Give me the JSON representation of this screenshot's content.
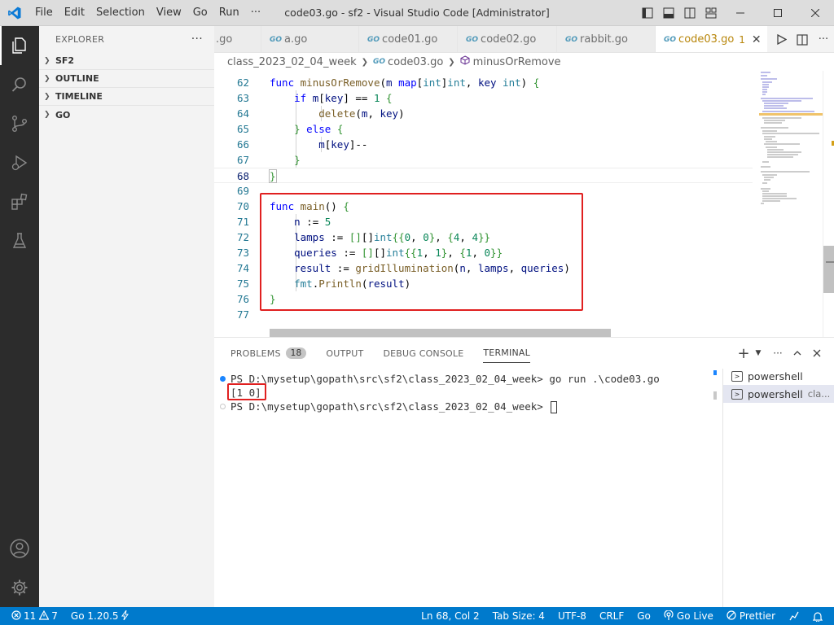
{
  "window": {
    "title": "code03.go - sf2 - Visual Studio Code [Administrator]",
    "menu": [
      "File",
      "Edit",
      "Selection",
      "View",
      "Go",
      "Run",
      "···"
    ]
  },
  "sidebar": {
    "header": "EXPLORER",
    "more": "···",
    "sections": [
      "SF2",
      "OUTLINE",
      "TIMELINE",
      "GO"
    ]
  },
  "tabs": [
    {
      "label": ".go",
      "icon": false
    },
    {
      "label": "a.go",
      "icon": true
    },
    {
      "label": "code01.go",
      "icon": true
    },
    {
      "label": "code02.go",
      "icon": true
    },
    {
      "label": "rabbit.go",
      "icon": true
    },
    {
      "label": "code03.go",
      "icon": true,
      "modified": "1",
      "active": true
    }
  ],
  "breadcrumb": {
    "folder": "class_2023_02_04_week",
    "file": "code03.go",
    "symbol": "minusOrRemove"
  },
  "editor": {
    "line_numbers": [
      "62",
      "63",
      "64",
      "65",
      "66",
      "67",
      "68",
      "69",
      "70",
      "71",
      "72",
      "73",
      "74",
      "75",
      "76",
      "77"
    ],
    "current_line": "68"
  },
  "panel": {
    "tabs": [
      "PROBLEMS",
      "OUTPUT",
      "DEBUG CONSOLE",
      "TERMINAL"
    ],
    "problems_count": "18",
    "active_tab": "TERMINAL",
    "terminal_lines": [
      "PS D:\\mysetup\\gopath\\src\\sf2\\class_2023_02_04_week> go run .\\code03.go",
      "[1 0]",
      "PS D:\\mysetup\\gopath\\src\\sf2\\class_2023_02_04_week> "
    ],
    "terminals": [
      {
        "name": "powershell",
        "sub": ""
      },
      {
        "name": "powershell",
        "sub": "cla..."
      }
    ]
  },
  "status": {
    "errors": "11",
    "warnings": "7",
    "go_version": "Go 1.20.5",
    "position": "Ln 68, Col 2",
    "tab_size": "Tab Size: 4",
    "encoding": "UTF-8",
    "eol": "CRLF",
    "language": "Go",
    "golive": "Go Live",
    "prettier": "Prettier"
  },
  "colors": {
    "accent": "#007acc",
    "highlight_box": "#e02020",
    "keyword": "#0000ff",
    "type": "#267f99"
  }
}
